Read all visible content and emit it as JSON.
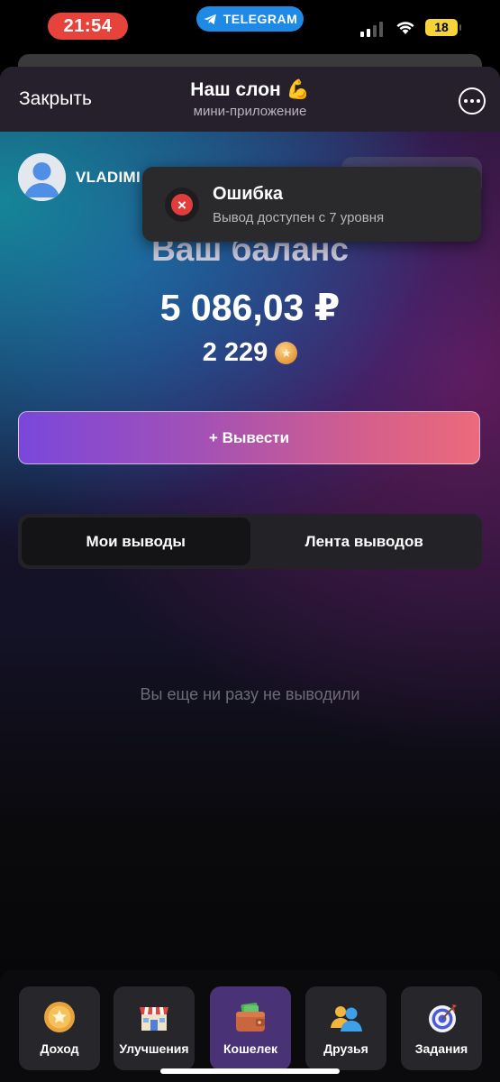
{
  "status_bar": {
    "time": "21:54",
    "telegram_label": "TELEGRAM",
    "battery": "18"
  },
  "header": {
    "close_label": "Закрыть",
    "title": "Наш слон 💪",
    "subtitle": "мини-приложение"
  },
  "user": {
    "name": "VLADIMI"
  },
  "toast": {
    "title": "Ошибка",
    "message": "Вывод доступен с 7 уровня",
    "icon": "error-x-icon",
    "icon_color": "#e23d3d"
  },
  "balance": {
    "label": "Ваш баланс",
    "amount": "5 086,03 ₽",
    "coins": "2 229",
    "coin_icon": "coin-icon"
  },
  "withdraw_button": {
    "label": "+ Вывести",
    "gradient_start": "#7a47db",
    "gradient_end": "#ec6a7a"
  },
  "tabs": [
    {
      "label": "Мои выводы",
      "active": true
    },
    {
      "label": "Лента выводов",
      "active": false
    }
  ],
  "empty_state": "Вы еще ни разу не выводили",
  "bottom_nav": [
    {
      "label": "Доход",
      "icon": "coin-icon",
      "active": false
    },
    {
      "label": "Улучшения",
      "icon": "shop-icon",
      "active": false
    },
    {
      "label": "Кошелек",
      "icon": "wallet-icon",
      "active": true
    },
    {
      "label": "Друзья",
      "icon": "friends-icon",
      "active": false
    },
    {
      "label": "Задания",
      "icon": "target-icon",
      "active": false
    }
  ]
}
